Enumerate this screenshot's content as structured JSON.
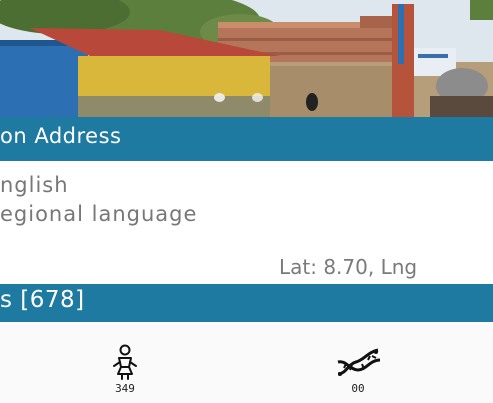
{
  "address_section": {
    "title": "on Address",
    "language_lines": [
      "nglish",
      "egional language"
    ],
    "coordinates": "Lat: 8.70, Lng"
  },
  "schools_section": {
    "title": "s [678]"
  },
  "stats": [
    {
      "icon": "girl-icon",
      "value": "349"
    },
    {
      "icon": "dna-icon",
      "value": "00"
    }
  ],
  "colors": {
    "accent": "#1f7aa1",
    "text_muted": "#777777"
  }
}
